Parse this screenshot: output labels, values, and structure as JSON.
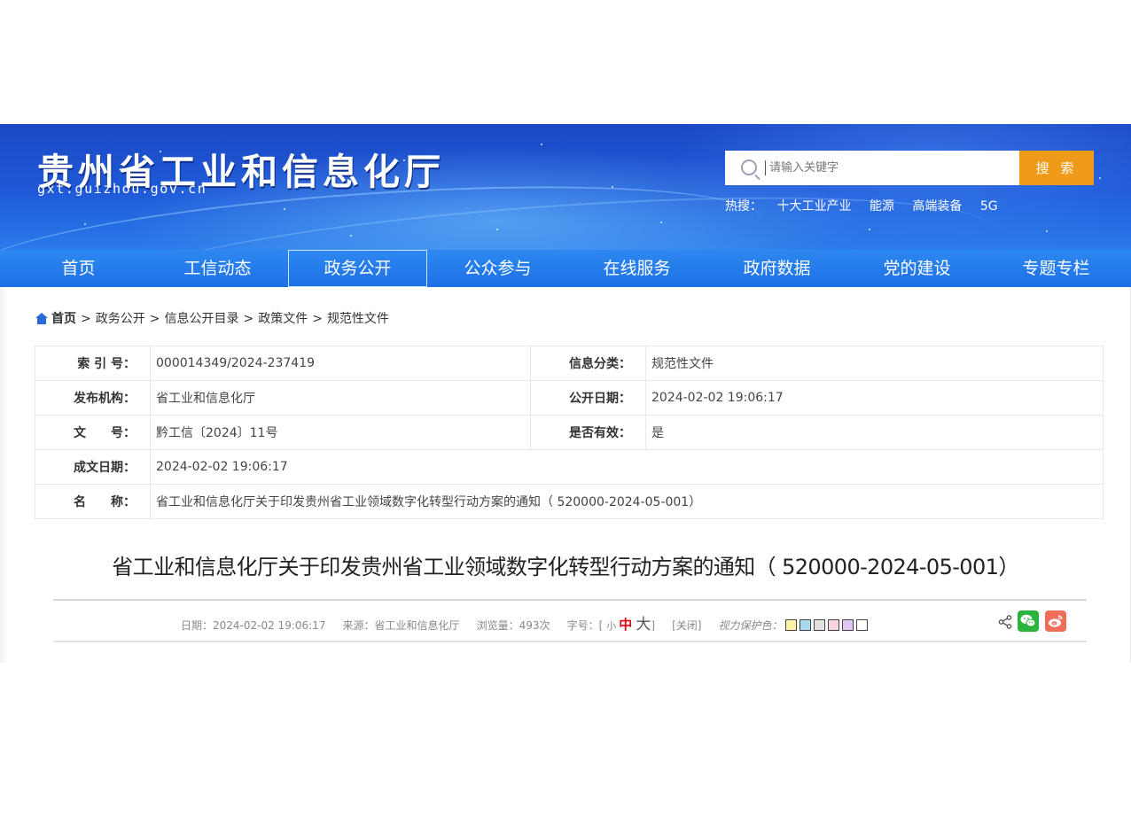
{
  "header": {
    "site_title": "贵州省工业和信息化厅",
    "site_domain": "gxt.guizhou.gov.cn",
    "search": {
      "placeholder": "请输入关键字",
      "button_label": "搜 索"
    },
    "hot": {
      "label": "热搜：",
      "items": [
        "十大工业产业",
        "能源",
        "高端装备",
        "5G"
      ]
    },
    "colors": {
      "banner": "#1f5ad8",
      "search_button": "#f09a1a",
      "nav": "#1c70e6"
    }
  },
  "nav": {
    "items": [
      "首页",
      "工信动态",
      "政务公开",
      "公众参与",
      "在线服务",
      "政府数据",
      "党的建设",
      "专题专栏"
    ],
    "active": "政务公开"
  },
  "breadcrumb": [
    "首页",
    "政务公开",
    "信息公开目录",
    "政策文件",
    "规范性文件"
  ],
  "meta": {
    "index_no": {
      "label": "索 引 号：",
      "value": "000014349/2024-237419"
    },
    "category": {
      "label": "信息分类：",
      "value": "规范性文件"
    },
    "publisher": {
      "label": "发布机构：",
      "value": "省工业和信息化厅"
    },
    "publish_date": {
      "label": "公开日期：",
      "value": "2024-02-02 19:06:17"
    },
    "doc_no": {
      "label": "文　　号：",
      "value": "黔工信〔2024〕11号"
    },
    "valid": {
      "label": "是否有效：",
      "value": "是"
    },
    "created_date": {
      "label": "成文日期：",
      "value": "2024-02-02 19:06:17"
    },
    "name": {
      "label": "名　　称：",
      "value": "省工业和信息化厅关于印发贵州省工业领域数字化转型行动方案的通知（ 520000-2024-05-001）"
    }
  },
  "article": {
    "title": "省工业和信息化厅关于印发贵州省工业领域数字化转型行动方案的通知（ 520000-2024-05-001）",
    "date": "日期：2024-02-02 19:06:17",
    "source": "来源：省工业和信息化厅",
    "views": "浏览量：493次",
    "font_size_label": "字号：[",
    "font_size_small": "小",
    "font_size_medium": "中",
    "font_size_large": "大",
    "font_size_close": "]",
    "close": "[关闭]",
    "eye_care_label": "视力保护色：",
    "eye_care_colors": [
      "#fdf3a7",
      "#a8d8ef",
      "#e1e1e1",
      "#f9d3dd",
      "#e2c7f3",
      "#ffffff"
    ],
    "share_icons": [
      "share-icon",
      "wechat-icon",
      "weibo-icon"
    ]
  }
}
